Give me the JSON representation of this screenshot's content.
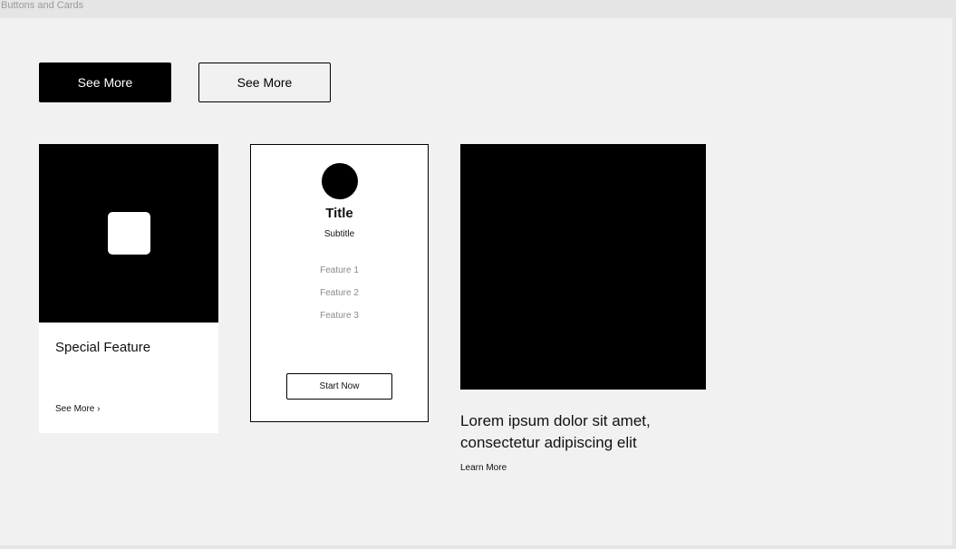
{
  "frame": {
    "label": "Buttons and Cards"
  },
  "buttons": {
    "primary_label": "See More",
    "secondary_label": "See More"
  },
  "card1": {
    "title": "Special Feature",
    "link_label": "See More ›"
  },
  "card2": {
    "title": "Title",
    "subtitle": "Subtitle",
    "features": [
      "Feature 1",
      "Feature 2",
      "Feature 3"
    ],
    "cta_label": "Start Now"
  },
  "card3": {
    "text": "Lorem ipsum dolor sit amet, consectetur adipiscing elit",
    "link_label": "Learn More"
  },
  "colors": {
    "background": "#f1f1f1",
    "primary": "#000000",
    "surface": "#ffffff",
    "muted_text": "#8a8a8a"
  }
}
